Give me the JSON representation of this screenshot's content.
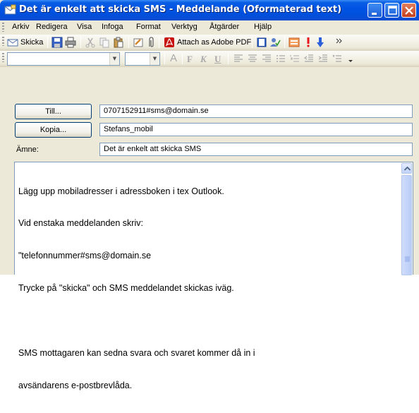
{
  "window": {
    "title": "Det är enkelt att skicka SMS - Meddelande (Oformaterad text)"
  },
  "menu": [
    {
      "label": "Arkiv"
    },
    {
      "label": "Redigera"
    },
    {
      "label": "Visa"
    },
    {
      "label": "Infoga"
    },
    {
      "label": "Format"
    },
    {
      "label": "Verktyg"
    },
    {
      "label": "Åtgärder"
    },
    {
      "label": "Hjälp"
    }
  ],
  "toolbar": {
    "send_label": "Skicka",
    "attach_pdf_label": "Attach as Adobe PDF"
  },
  "format_toolbar": {
    "font_name": "",
    "font_size": "",
    "bold": "F",
    "italic": "K",
    "underline": "U",
    "font_color": "A"
  },
  "header": {
    "to_button": "Till...",
    "to_value": "0707152911#sms@domain.se",
    "cc_button": "Kopia...",
    "cc_value": "Stefans_mobil",
    "subject_label": "Ämne:",
    "subject_value": "Det är enkelt att skicka SMS"
  },
  "body": {
    "lines": [
      "Lägg upp mobiladresser i adressboken i tex Outlook.",
      "Vid enstaka meddelanden skriv:",
      "\"telefonnummer#sms@domain.se",
      "Trycke på \"skicka\" och SMS meddelandet skickas iväg.",
      "",
      "SMS mottagaren kan sedna svara och svaret kommer då in i",
      "avsändarens e-postbrevlåda."
    ]
  },
  "colors": {
    "titlebar": "#0054e3",
    "window_bg": "#ece9d8",
    "field_border": "#7f9db9"
  }
}
